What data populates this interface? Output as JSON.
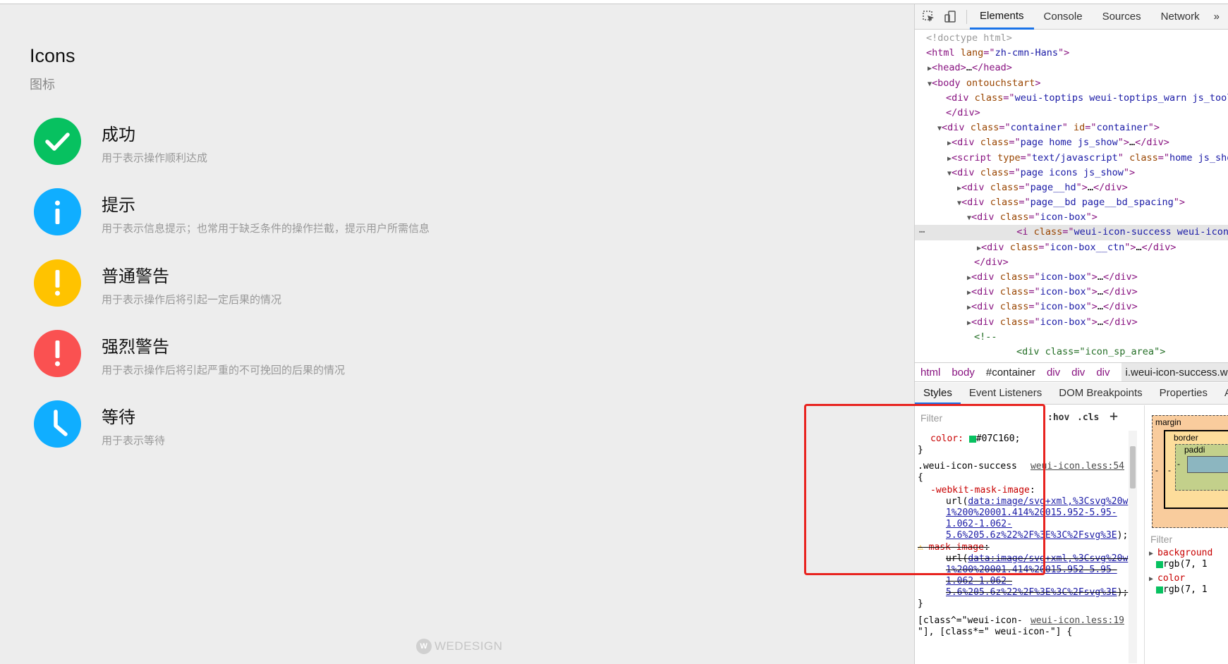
{
  "page": {
    "title": "Icons",
    "subtitle": "图标",
    "items": [
      {
        "title": "成功",
        "desc": "用于表示操作顺利达成",
        "color": "#07C160",
        "icon": "check-icon"
      },
      {
        "title": "提示",
        "desc": "用于表示信息提示；也常用于缺乏条件的操作拦截，提示用户所需信息",
        "color": "#10AEFF",
        "icon": "info-icon"
      },
      {
        "title": "普通警告",
        "desc": "用于表示操作后将引起一定后果的情况",
        "color": "#FFC300",
        "icon": "warn-icon"
      },
      {
        "title": "强烈警告",
        "desc": "用于表示操作后将引起严重的不可挽回的后果的情况",
        "color": "#FA5151",
        "icon": "warn-icon"
      },
      {
        "title": "等待",
        "desc": "用于表示等待",
        "color": "#10AEFF",
        "icon": "clock-icon"
      }
    ],
    "footer": "WEDESIGN"
  },
  "devtools": {
    "tabs": [
      "Elements",
      "Console",
      "Sources",
      "Network"
    ],
    "more": "»",
    "crumbs": [
      "html",
      "body",
      "#container",
      "div",
      "div",
      "div",
      "i.weui-icon-success.w"
    ],
    "style_tabs": [
      "Styles",
      "Event Listeners",
      "DOM Breakpoints",
      "Properties",
      "Ac"
    ],
    "filter_placeholder": "Filter",
    "hov": ":hov",
    "cls": ".cls",
    "color_rule": "color: ",
    "color_value": "#07C160;",
    "selector1": ".weui-icon-success",
    "link1": "weui-icon.less:54",
    "prop1": "-webkit-mask-image",
    "url_lines": [
      "data:image/svg+xml,%3Csvg%20w",
      "1%200%20001.414%20015.952-5.95-",
      "1.062-1.062-",
      "5.6%205.6z%22%2F%3E%3C%2Fsvg%3E"
    ],
    "prop2": "mask-image",
    "selector2": "[class^=\"weui-icon-",
    "selector2b": "\"], [class*=\" weui-icon-\"] {",
    "link2": "weui-icon.less:19",
    "box_labels": {
      "margin": "margin",
      "border": "border",
      "padding": "paddi",
      "dash": "-"
    },
    "computed_filter": "Filter",
    "computed": [
      {
        "name": "background",
        "value": "rgb(7, 1"
      },
      {
        "name": "color",
        "value": "rgb(7, 1"
      }
    ],
    "swatch_color": "#07C160"
  }
}
